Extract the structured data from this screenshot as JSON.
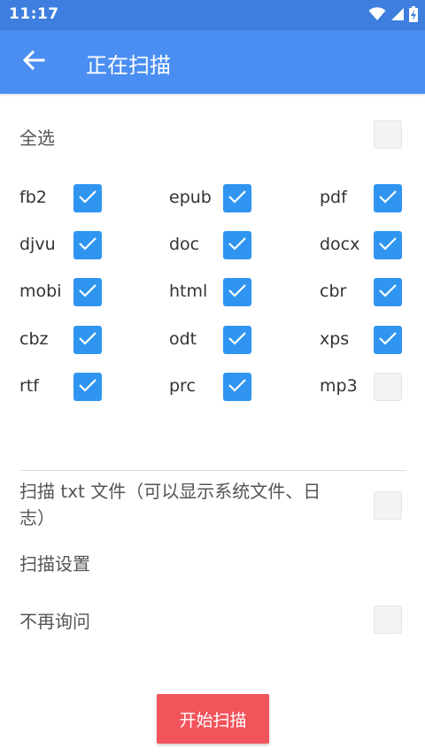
{
  "status_bar": {
    "time": "11:17",
    "icons": [
      "wifi-icon",
      "signal-icon",
      "battery-icon"
    ]
  },
  "app_bar": {
    "title": "正在扫描",
    "back_icon": "arrow-left-icon"
  },
  "select_all": {
    "label": "全选",
    "checked": false
  },
  "formats": [
    {
      "label": "fb2",
      "checked": true
    },
    {
      "label": "epub",
      "checked": true
    },
    {
      "label": "pdf",
      "checked": true
    },
    {
      "label": "djvu",
      "checked": true
    },
    {
      "label": "doc",
      "checked": true
    },
    {
      "label": "docx",
      "checked": true
    },
    {
      "label": "mobi",
      "checked": true
    },
    {
      "label": "html",
      "checked": true
    },
    {
      "label": "cbr",
      "checked": true
    },
    {
      "label": "cbz",
      "checked": true
    },
    {
      "label": "odt",
      "checked": true
    },
    {
      "label": "xps",
      "checked": true
    },
    {
      "label": "rtf",
      "checked": true
    },
    {
      "label": "prc",
      "checked": true
    },
    {
      "label": "mp3",
      "checked": false
    }
  ],
  "scan_txt": {
    "label": "扫描 txt 文件（可以显示系统文件、日志）",
    "checked": false
  },
  "scan_settings": {
    "label": "扫描设置"
  },
  "no_ask": {
    "label": "不再询问",
    "checked": false
  },
  "start_button": {
    "label": "开始扫描"
  },
  "colors": {
    "primary": "#4a8ef2",
    "status_bar": "#3d7edf",
    "checkbox_on": "#2f95f0",
    "button": "#f2545b"
  }
}
